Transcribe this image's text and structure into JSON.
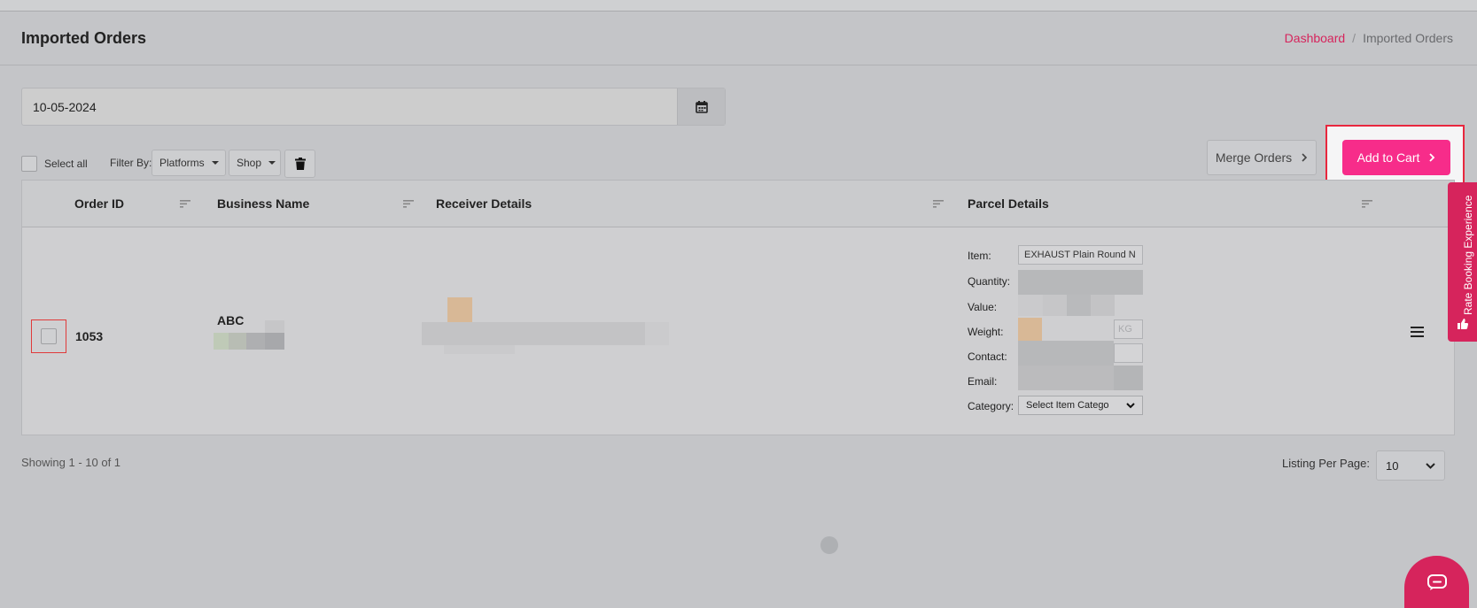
{
  "header": {
    "title": "Imported Orders",
    "breadcrumb": {
      "link": "Dashboard",
      "separator": "/",
      "current": "Imported Orders"
    }
  },
  "date_filter": {
    "value": "10-05-2024",
    "icon": "calendar-icon"
  },
  "toolbar": {
    "select_all_label": "Select all",
    "filter_by_label": "Filter By:",
    "platforms_label": "Platforms",
    "shop_label": "Shop",
    "delete_icon": "trash-icon",
    "merge_label": "Merge Orders",
    "add_to_cart_label": "Add to Cart"
  },
  "table": {
    "columns": [
      "Order ID",
      "Business Name",
      "Receiver Details",
      "Parcel Details"
    ],
    "rows": [
      {
        "order_id": "1053",
        "business_name": "ABC",
        "parcel": {
          "item_label": "Item:",
          "item_value": "EXHAUST Plain Round N",
          "quantity_label": "Quantity:",
          "value_label": "Value:",
          "weight_label": "Weight:",
          "weight_unit": "KG",
          "contact_label": "Contact:",
          "email_label": "Email:",
          "category_label": "Category:",
          "category_value": "Select Item Catego"
        }
      }
    ]
  },
  "footer": {
    "showing": "Showing 1 - 10 of 1",
    "listing_label": "Listing Per Page:",
    "listing_value": "10"
  },
  "side_tab": {
    "label": "Rate Booking Experience"
  },
  "colors": {
    "accent": "#d6245c",
    "button_pink": "#f72c8a",
    "highlight_red": "#e8273e"
  }
}
